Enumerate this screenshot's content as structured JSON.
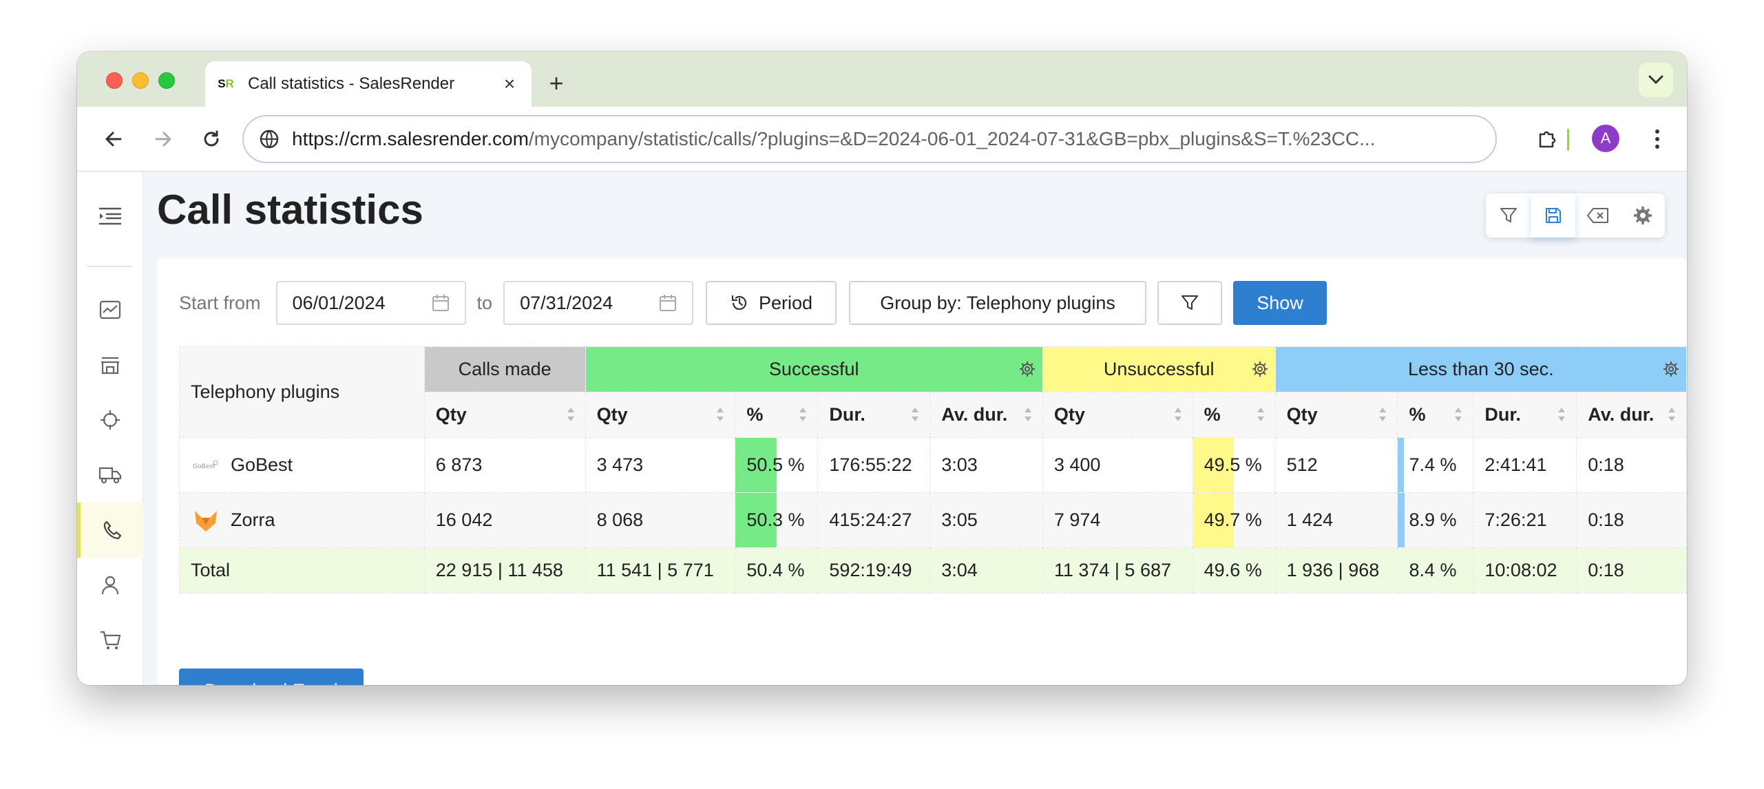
{
  "browser": {
    "tab_title": "Call statistics - SalesRender",
    "favicon_text_1": "S",
    "favicon_text_2": "R",
    "url_host": "https://crm.salesrender.com",
    "url_path": "/mycompany/statistic/calls/?plugins=&D=2024-06-01_2024-07-31&GB=pbx_plugins&S=T.%23CC...",
    "profile_initial": "A"
  },
  "page": {
    "title": "Call statistics"
  },
  "filters": {
    "start_label": "Start from",
    "start_date": "06/01/2024",
    "to_label": "to",
    "end_date": "07/31/2024",
    "period_label": "Period",
    "group_by_label": "Group by: Telephony plugins",
    "show_label": "Show"
  },
  "table": {
    "row_header": "Telephony plugins",
    "groups": {
      "calls": "Calls made",
      "successful": "Successful",
      "unsuccessful": "Unsuccessful",
      "less30": "Less than 30 sec."
    },
    "sub": {
      "qty": "Qty",
      "pct": "%",
      "dur": "Dur.",
      "avdur": "Av. dur."
    },
    "rows": [
      {
        "name": "GoBest",
        "calls_qty": "6 873",
        "succ_qty": "3 473",
        "succ_pct": "50.5 %",
        "succ_pct_value": 50.5,
        "succ_dur": "176:55:22",
        "succ_avdur": "3:03",
        "uns_qty": "3 400",
        "uns_pct": "49.5 %",
        "uns_pct_value": 49.5,
        "less_qty": "512",
        "less_pct": "7.4 %",
        "less_pct_value": 7.4,
        "less_dur": "2:41:41",
        "less_avdur": "0:18"
      },
      {
        "name": "Zorra",
        "calls_qty": "16 042",
        "succ_qty": "8 068",
        "succ_pct": "50.3 %",
        "succ_pct_value": 50.3,
        "succ_dur": "415:24:27",
        "succ_avdur": "3:05",
        "uns_qty": "7 974",
        "uns_pct": "49.7 %",
        "uns_pct_value": 49.7,
        "less_qty": "1 424",
        "less_pct": "8.9 %",
        "less_pct_value": 8.9,
        "less_dur": "7:26:21",
        "less_avdur": "0:18"
      }
    ],
    "total": {
      "label": "Total",
      "calls_qty": "22 915 | 11 458",
      "succ_qty": "11 541 | 5 771",
      "succ_pct": "50.4 %",
      "succ_dur": "592:19:49",
      "succ_avdur": "3:04",
      "uns_qty": "11 374 | 5 687",
      "uns_pct": "49.6 %",
      "less_qty": "1 936 | 968",
      "less_pct": "8.4 %",
      "less_dur": "10:08:02",
      "less_avdur": "0:18"
    }
  },
  "download_label": "Download Excel",
  "colors": {
    "successful": "#77ea88",
    "unsuccessful": "#fff98a",
    "less30": "#8dcdf7",
    "primary": "#2f7fd1"
  }
}
